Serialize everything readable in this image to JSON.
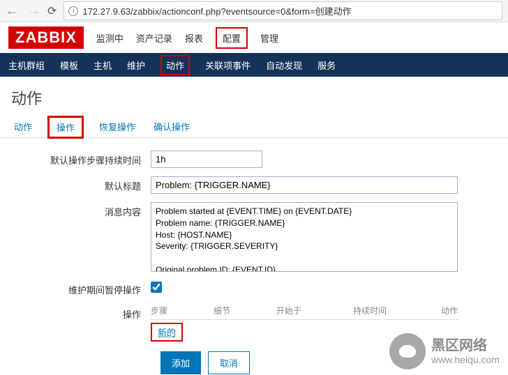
{
  "browser": {
    "url": "172.27.9.63/zabbix/actionconf.php?eventsource=0&form=创建动作"
  },
  "logo": "ZABBIX",
  "top_nav": {
    "items": [
      "监测中",
      "资产记录",
      "报表",
      "配置",
      "管理"
    ],
    "highlighted_index": 3
  },
  "sub_nav": {
    "items": [
      "主机群组",
      "模板",
      "主机",
      "维护",
      "动作",
      "关联项事件",
      "自动发现",
      "服务"
    ],
    "highlighted_index": 4
  },
  "page_title": "动作",
  "tabs": {
    "items": [
      "动作",
      "操作",
      "恢复操作",
      "确认操作"
    ],
    "highlighted_index": 1
  },
  "form": {
    "duration_label": "默认操作步骤持续时间",
    "duration_value": "1h",
    "title_label": "默认标题",
    "title_value": "Problem: {TRIGGER.NAME}",
    "message_label": "消息内容",
    "message_value": "Problem started at {EVENT.TIME} on {EVENT.DATE}\nProblem name: {TRIGGER.NAME}\nHost: {HOST.NAME}\nSeverity: {TRIGGER.SEVERITY}\n\nOriginal problem ID: {EVENT.ID}\n{TRIGGER.URL}",
    "pause_label": "维护期间暂停操作",
    "ops_label": "操作",
    "ops_columns": [
      "步骤",
      "细节",
      "开始于",
      "持续时间",
      "动作"
    ],
    "new_link": "新的"
  },
  "buttons": {
    "add": "添加",
    "cancel": "取消"
  },
  "watermark": {
    "title": "黑区网络",
    "url": "www.heiqu.com"
  }
}
